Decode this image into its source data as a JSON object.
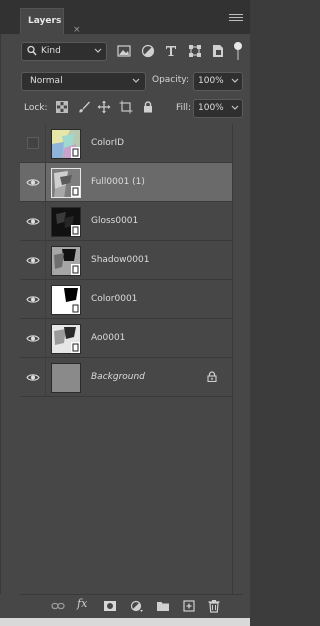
{
  "panel": {
    "tab_label": "Layers",
    "close_glyph": "×"
  },
  "filter": {
    "kind_label": "Kind",
    "icons": [
      "image-filter-icon",
      "adjustment-filter-icon",
      "type-filter-icon",
      "shape-filter-icon",
      "smart-object-filter-icon"
    ]
  },
  "blend": {
    "mode": "Normal",
    "opacity_label": "Opacity:",
    "opacity_value": "100%"
  },
  "lock": {
    "label": "Lock:",
    "fill_label": "Fill:",
    "fill_value": "100%",
    "icons": [
      "lock-transparent-pixels-icon",
      "lock-image-pixels-icon",
      "lock-position-icon",
      "lock-artboard-icon",
      "lock-all-icon"
    ]
  },
  "layers": [
    {
      "name": "ColorID",
      "visible": false,
      "selected": false,
      "italic": false,
      "locked": false,
      "thumb": "colorid"
    },
    {
      "name": "Full0001 (1)",
      "visible": true,
      "selected": true,
      "italic": false,
      "locked": false,
      "thumb": "full"
    },
    {
      "name": "Gloss0001",
      "visible": true,
      "selected": false,
      "italic": false,
      "locked": false,
      "thumb": "gloss"
    },
    {
      "name": "Shadow0001",
      "visible": true,
      "selected": false,
      "italic": false,
      "locked": false,
      "thumb": "shadow"
    },
    {
      "name": "Color0001",
      "visible": true,
      "selected": false,
      "italic": false,
      "locked": false,
      "thumb": "color"
    },
    {
      "name": "Ao0001",
      "visible": true,
      "selected": false,
      "italic": false,
      "locked": false,
      "thumb": "ao"
    },
    {
      "name": "Background",
      "visible": true,
      "selected": false,
      "italic": true,
      "locked": true,
      "thumb": "background"
    }
  ],
  "footer": {
    "fx_label": "fx",
    "icons": [
      "link-layers-icon",
      "fx-icon",
      "add-mask-icon",
      "new-adjustment-icon",
      "new-group-icon",
      "new-layer-icon",
      "delete-layer-icon"
    ]
  },
  "colors": {
    "panel_bg": "#474747",
    "selected_row": "#6a6a6a",
    "background_thumb": "#8a8a8a"
  }
}
